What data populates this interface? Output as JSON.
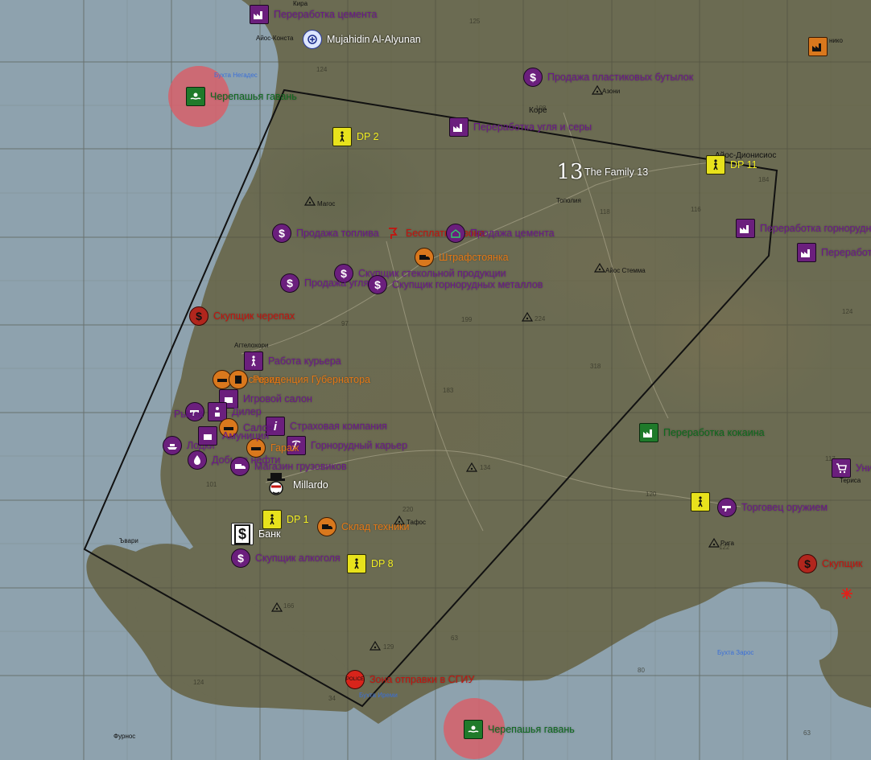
{
  "markers": [
    {
      "id": "cement-processing",
      "text": "Переработка цемента",
      "color": "#6b1a8a"
    },
    {
      "id": "mujahidin",
      "text": "Mujahidin Al-Alyunan",
      "color": "#ffffff"
    },
    {
      "id": "turtle-harbor-north",
      "text": "Черепашья гавань",
      "color": "#0f6a1e"
    },
    {
      "id": "plastic-bottles",
      "text": "Продажа пластиковых бутылок",
      "color": "#6b1a8a"
    },
    {
      "id": "coal-processing",
      "text": "Переработка угля и серы",
      "color": "#6b1a8a"
    },
    {
      "id": "dp2",
      "text": "DP 2",
      "color": "#f2ee22"
    },
    {
      "id": "family13",
      "text": "The Family 13",
      "color": "#ffffff"
    },
    {
      "id": "dp11",
      "text": "DP 11",
      "color": "#f2ee22"
    },
    {
      "id": "ore-processing",
      "text": "Переработка горнорудн",
      "color": "#6b1a8a"
    },
    {
      "id": "processing-right",
      "text": "Переработ",
      "color": "#6b1a8a"
    },
    {
      "id": "fuel-sale",
      "text": "Продажа топлива",
      "color": "#6b1a8a"
    },
    {
      "id": "free-zone",
      "text": "Бесплатная зона",
      "color": "#c3140f"
    },
    {
      "id": "cement-sale",
      "text": "Продажа цемента",
      "color": "#6b1a8a"
    },
    {
      "id": "impound",
      "text": "Штрафстоянка",
      "color": "#e27716"
    },
    {
      "id": "glass-buyer",
      "text": "Скупщик стекольной продукции",
      "color": "#6b1a8a"
    },
    {
      "id": "coal-sale",
      "text": "Продажа угля",
      "color": "#6b1a8a"
    },
    {
      "id": "ore-buyer",
      "text": "Скупщик горнорудных металлов",
      "color": "#6b1a8a"
    },
    {
      "id": "turtle-buyer",
      "text": "Скупщик черепах",
      "color": "#c3140f"
    },
    {
      "id": "courier",
      "text": "Работа курьера",
      "color": "#6b1a8a"
    },
    {
      "id": "governor",
      "text": "Резиденция Губернатора",
      "color": "#e27716"
    },
    {
      "id": "insurance",
      "text": "Страховая компания",
      "color": "#6b1a8a"
    },
    {
      "id": "ore-quarry",
      "text": "Горнорудный карьер",
      "color": "#6b1a8a"
    },
    {
      "id": "mining-dobycha",
      "text": "Добыча нефти",
      "color": "#6b1a8a"
    },
    {
      "id": "truck-shop",
      "text": "Магазин грузовиков",
      "color": "#6b1a8a"
    },
    {
      "id": "millardo",
      "text": "Millardo",
      "color": "#ffffff"
    },
    {
      "id": "dp1",
      "text": "DP 1",
      "color": "#f2ee22"
    },
    {
      "id": "bank",
      "text": "Банк",
      "color": "#ffffff"
    },
    {
      "id": "car-warehouse",
      "text": "Склад техники",
      "color": "#e27716"
    },
    {
      "id": "alcohol-buyer",
      "text": "Скупщик алкоголя",
      "color": "#6b1a8a"
    },
    {
      "id": "dp8",
      "text": "DP 8",
      "color": "#f2ee22"
    },
    {
      "id": "cocaine-processing",
      "text": "Переработка кокаина",
      "color": "#0f6a1e"
    },
    {
      "id": "arms-dealer",
      "text": "Торговец оружием",
      "color": "#6b1a8a"
    },
    {
      "id": "uni",
      "text": "Уни",
      "color": "#6b1a8a"
    },
    {
      "id": "buyer-right",
      "text": "Скупщик",
      "color": "#c3140f"
    },
    {
      "id": "sgiu-zone",
      "text": "Зона отправки в СГИУ",
      "color": "#c3140f"
    },
    {
      "id": "turtle-harbor-south",
      "text": "Черепашья гавань",
      "color": "#0f6a1e"
    },
    {
      "id": "cluster-1",
      "text": "Ресторан",
      "color": "#e27716"
    },
    {
      "id": "cluster-2",
      "text": "Гараж",
      "color": "#e27716"
    },
    {
      "id": "cluster-3",
      "text": "Игровой салон",
      "color": "#6b1a8a"
    },
    {
      "id": "cluster-4",
      "text": "Дилер",
      "color": "#6b1a8a"
    },
    {
      "id": "cluster-5",
      "text": "Салон",
      "color": "#6b1a8a"
    },
    {
      "id": "cluster-6",
      "text": "Лодки",
      "color": "#6b1a8a"
    },
    {
      "id": "cluster-7",
      "text": "Рынок",
      "color": "#6b1a8a"
    },
    {
      "id": "cluster-8",
      "text": "Амуниция",
      "color": "#6b1a8a"
    }
  ],
  "towns": [
    {
      "id": "kira",
      "text": "Кира"
    },
    {
      "id": "ayos-konst",
      "text": "Айос-Конста"
    },
    {
      "id": "nikno",
      "text": "нико"
    },
    {
      "id": "azomi",
      "text": "Азони"
    },
    {
      "id": "kore",
      "text": "Коре"
    },
    {
      "id": "ayos-dionisios",
      "text": "Айос-Дионисиос"
    },
    {
      "id": "topolia",
      "text": "Тополия"
    },
    {
      "id": "magos",
      "text": "Магос"
    },
    {
      "id": "ayos-stemma",
      "text": "Айос Стемма"
    },
    {
      "id": "agelochori",
      "text": "Агтелохори"
    },
    {
      "id": "tafos",
      "text": "Тафос"
    },
    {
      "id": "therisa",
      "text": "Териса"
    },
    {
      "id": "riga",
      "text": "Рига"
    },
    {
      "id": "fournos",
      "text": "Фурнос"
    },
    {
      "id": "evrg",
      "text": "Ъвари"
    }
  ],
  "water": [
    {
      "id": "negades",
      "text": "Бухта Негадес"
    },
    {
      "id": "zaros",
      "text": "Бухта Зарос"
    },
    {
      "id": "iremi",
      "text": "Бухта Иреми"
    }
  ],
  "gridnums": [
    "125",
    "124",
    "116",
    "118",
    "184",
    "124",
    "97",
    "199",
    "224",
    "318",
    "183",
    "134",
    "101",
    "120",
    "220",
    "166",
    "129",
    "63",
    "80",
    "124",
    "34",
    "63",
    "122",
    "117",
    "108"
  ],
  "colors": {
    "sea": "#8ea2ae",
    "land": "#6b6b52",
    "purple": "#6b1a8a",
    "green": "#0f6a1e",
    "red": "#c3140f",
    "orange": "#e27716",
    "yellow": "#f2ee22",
    "zone_ring": "#de5a64"
  }
}
